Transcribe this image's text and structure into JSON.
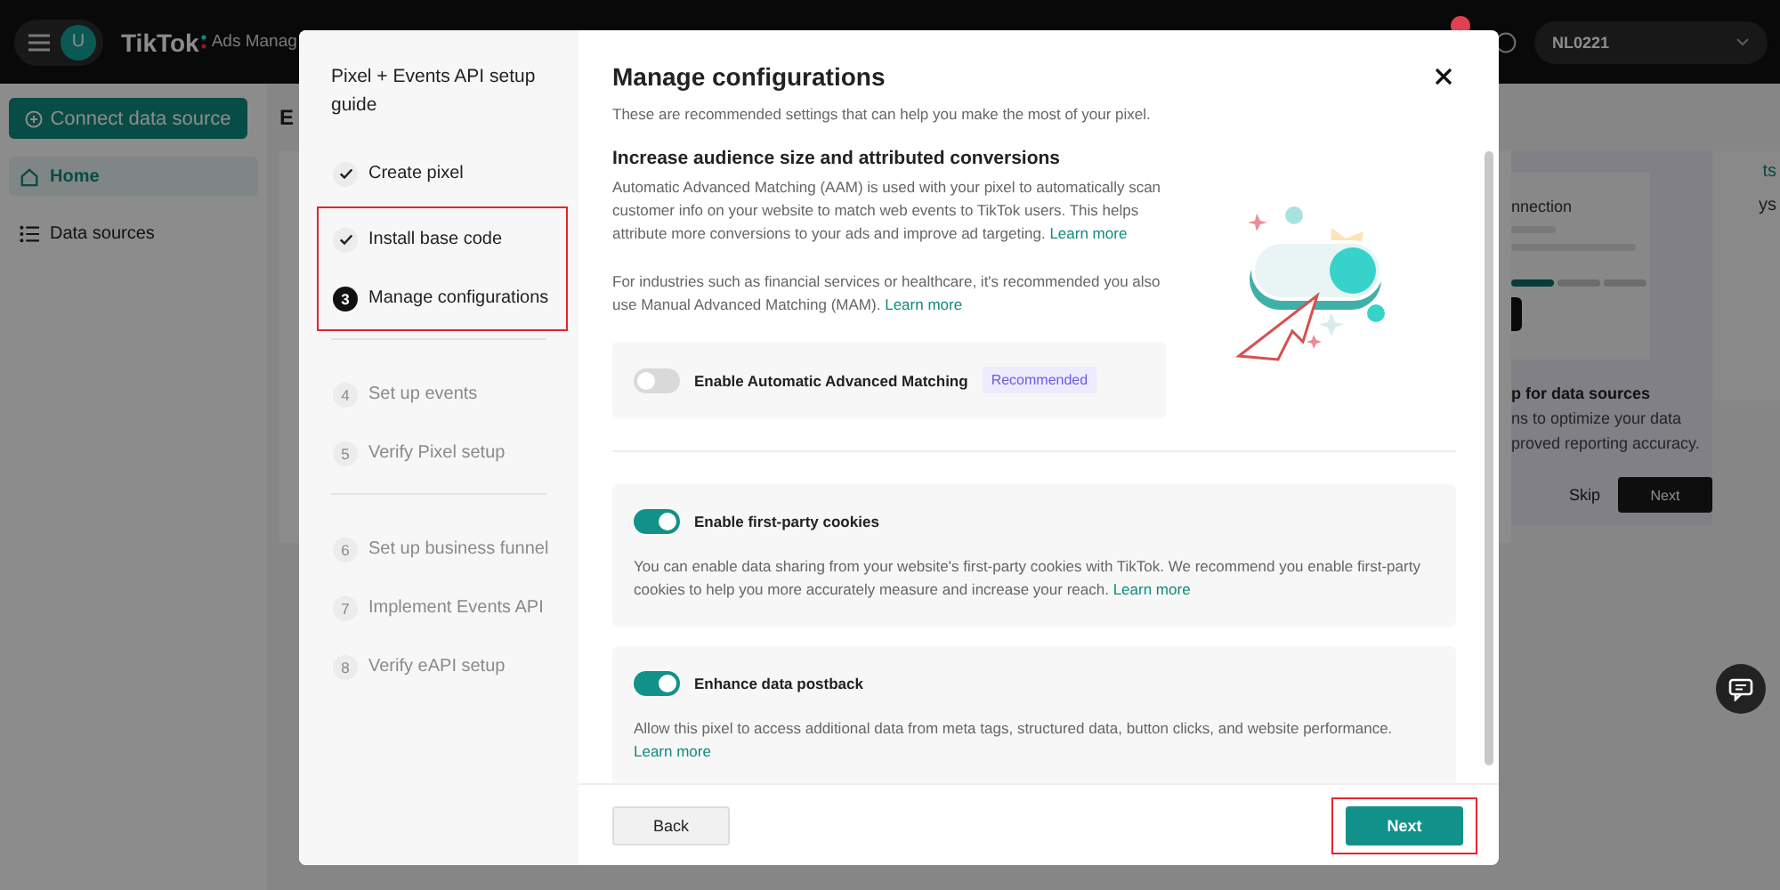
{
  "topbar": {
    "avatar": "U",
    "brand": "TikTok",
    "product": "Ads Manag",
    "account": "NL0221"
  },
  "sidebar": {
    "connect_button": "Connect data source",
    "items": [
      {
        "label": "Home",
        "selected": true,
        "kind": "home"
      },
      {
        "label": "Data sources",
        "selected": false,
        "kind": "list"
      }
    ]
  },
  "main": {
    "title": "E",
    "side_texts": [
      "ts",
      "ys"
    ]
  },
  "guide_card": {
    "status": "nnection",
    "progress": [
      {
        "done": true
      },
      {
        "done": false
      },
      {
        "done": false
      }
    ],
    "title": "p for data sources",
    "lines": [
      "ns to optimize your data",
      "proved reporting accuracy."
    ],
    "skip": "Skip",
    "next": "Next"
  },
  "dialog": {
    "guide_title": "Pixel + Events API setup guide",
    "step_groups": [
      {
        "divider": false,
        "highlighted": false,
        "steps": [
          {
            "label": "Create pixel",
            "kind": "done"
          }
        ]
      },
      {
        "divider": false,
        "highlighted": true,
        "steps": [
          {
            "label": "Install base code",
            "kind": "done"
          },
          {
            "number": "3",
            "label": "Manage configurations",
            "kind": "current"
          }
        ]
      },
      {
        "divider": true,
        "highlighted": false,
        "steps": [
          {
            "number": "4",
            "label": "Set up events",
            "kind": "todo"
          },
          {
            "number": "5",
            "label": "Verify Pixel setup",
            "kind": "todo"
          }
        ]
      },
      {
        "divider": true,
        "highlighted": false,
        "steps": [
          {
            "number": "6",
            "label": "Set up business funnel",
            "kind": "todo"
          },
          {
            "number": "7",
            "label": "Implement Events API",
            "kind": "todo"
          },
          {
            "number": "8",
            "label": "Verify eAPI setup",
            "kind": "todo"
          }
        ]
      }
    ],
    "title": "Manage configurations",
    "subtitle": "These are recommended settings that can help you make the most of your pixel.",
    "section_title": "Increase audience size and attributed conversions",
    "paragraphs": [
      {
        "text": "Automatic Advanced Matching (AAM) is used with your pixel to automatically scan customer info on your website to match web events to TikTok users. This helps attribute more conversions to your ads and improve ad targeting.",
        "link": "Learn more"
      },
      {
        "text": "For industries such as financial services or healthcare, it's recommended you also use Manual Advanced Matching (MAM).",
        "link": "Learn more"
      }
    ],
    "matching_setting": {
      "label": "Enable Automatic Advanced Matching",
      "on": false,
      "badge": "Recommended"
    },
    "settings": [
      {
        "label": "Enable first-party cookies",
        "on": true,
        "description": "You can enable data sharing from your website's first-party cookies with TikTok. We recommend you enable first-party cookies to help you more accurately measure and increase your reach.",
        "link": "Learn more"
      },
      {
        "label": "Enhance data postback",
        "on": true,
        "description": "Allow this pixel to access additional data from meta tags, structured data, button clicks, and website performance.",
        "link": "Learn more"
      }
    ],
    "footer": {
      "back": "Back",
      "next": "Next",
      "next_highlighted": true
    }
  }
}
